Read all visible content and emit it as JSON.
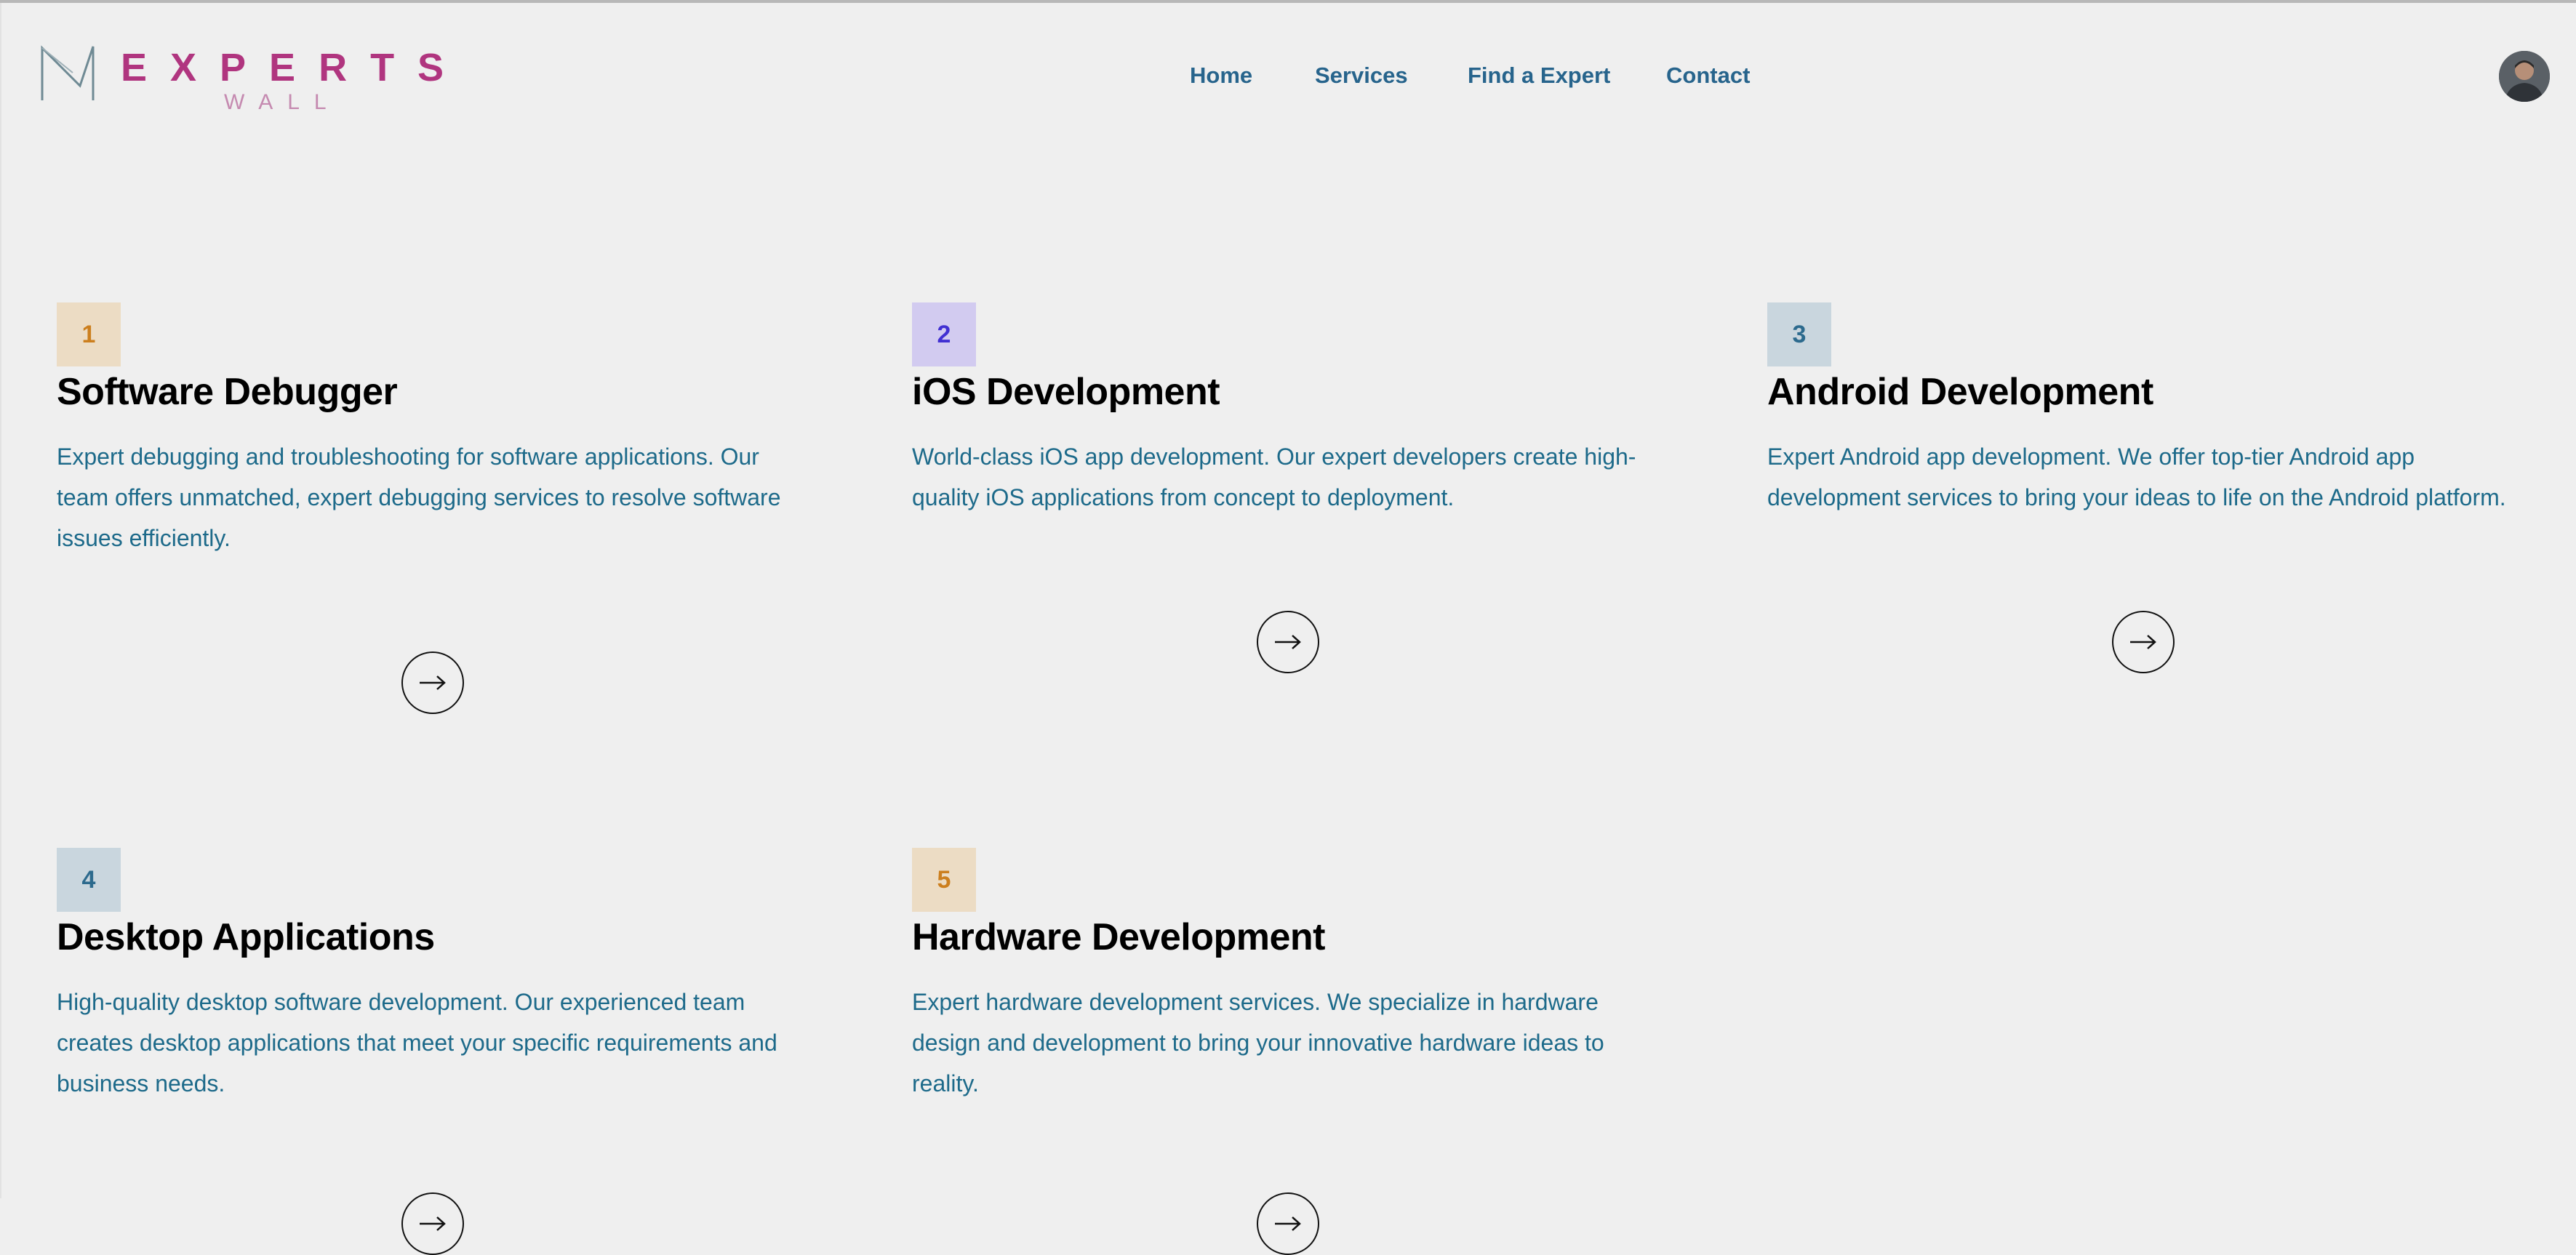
{
  "brand": {
    "name": "EXPERTS",
    "sub": "WALL"
  },
  "nav": {
    "home": "Home",
    "services": "Services",
    "find": "Find a Expert",
    "contact": "Contact"
  },
  "colors": {
    "background": "#efefef",
    "nav_link": "#27648c",
    "description": "#1d6a8a",
    "brand": "#b0357f"
  },
  "icons": {
    "logo": "logo-m-icon",
    "arrow": "arrow-right-icon",
    "avatar": "user-avatar"
  },
  "services": [
    {
      "number": "1",
      "title": "Software Debugger",
      "description": "Expert debugging and troubleshooting for software applications. Our team offers unmatched, expert debugging services to resolve software issues efficiently."
    },
    {
      "number": "2",
      "title": "iOS Development",
      "description": "World-class iOS app development. Our expert developers create high-quality iOS applications from concept to deployment."
    },
    {
      "number": "3",
      "title": "Android Development",
      "description": "Expert Android app development. We offer top-tier Android app development services to bring your ideas to life on the Android platform."
    },
    {
      "number": "4",
      "title": "Desktop Applications",
      "description": "High-quality desktop software development. Our experienced team creates desktop applications that meet your specific requirements and business needs."
    },
    {
      "number": "5",
      "title": "Hardware Development",
      "description": "Expert hardware development services. We specialize in hardware design and development to bring your innovative hardware ideas to reality."
    }
  ]
}
